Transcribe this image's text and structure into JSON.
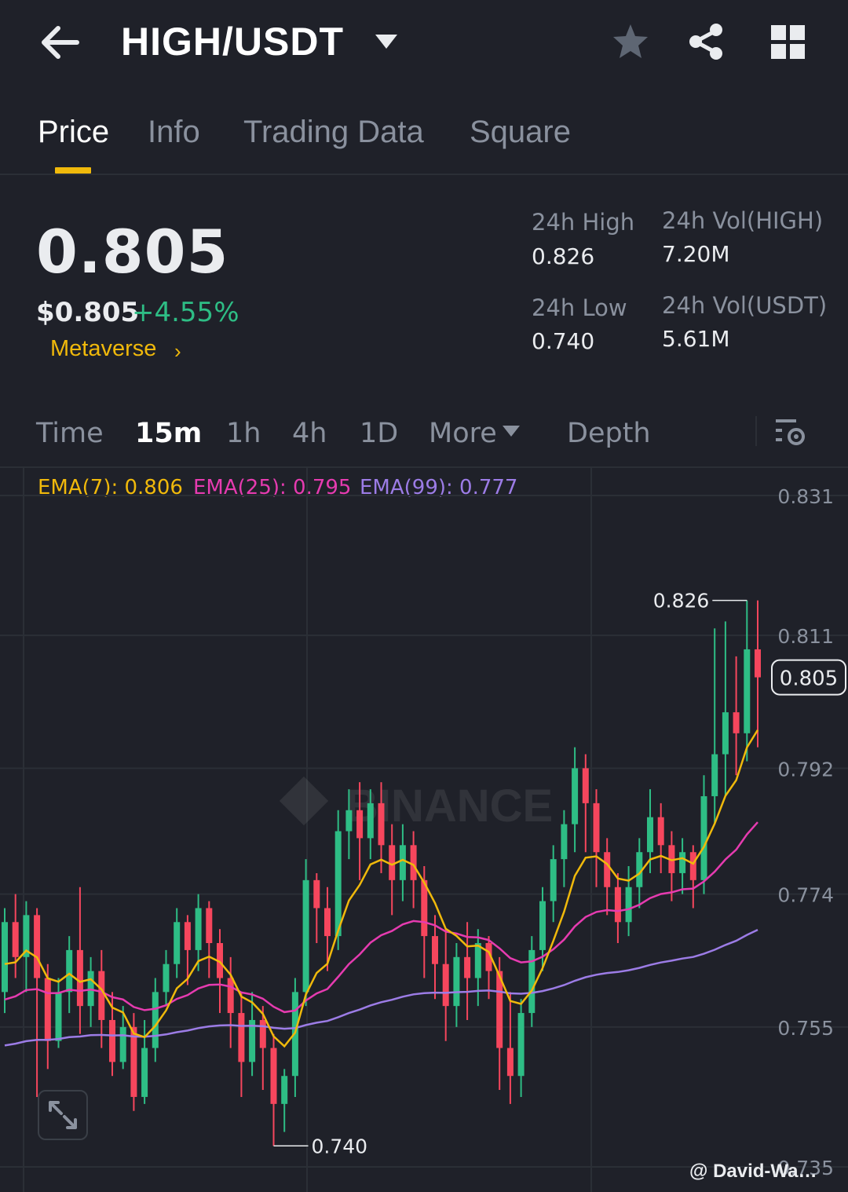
{
  "header": {
    "pair": "HIGH/USDT",
    "icons": [
      "back-arrow-icon",
      "caret-down-icon",
      "star-icon",
      "share-icon",
      "grid-icon"
    ]
  },
  "tabs": [
    {
      "label": "Price",
      "active": true
    },
    {
      "label": "Info",
      "active": false
    },
    {
      "label": "Trading Data",
      "active": false
    },
    {
      "label": "Square",
      "active": false
    }
  ],
  "ticker": {
    "last_price": "0.805",
    "usd_price": "$0.805",
    "change": "+4.55%",
    "tag": "Metaverse",
    "stats": {
      "high_label": "24h High",
      "high_value": "0.826",
      "low_label": "24h Low",
      "low_value": "0.740",
      "vol_base_label": "24h Vol(HIGH)",
      "vol_base_value": "7.20M",
      "vol_quote_label": "24h Vol(USDT)",
      "vol_quote_value": "5.61M"
    }
  },
  "intervals": [
    {
      "label": "Time",
      "active": false
    },
    {
      "label": "15m",
      "active": true
    },
    {
      "label": "1h",
      "active": false
    },
    {
      "label": "4h",
      "active": false
    },
    {
      "label": "1D",
      "active": false
    },
    {
      "label": "More",
      "active": false
    },
    {
      "label": "Depth",
      "active": false
    }
  ],
  "indicators": {
    "ema7": "EMA(7): 0.806",
    "ema25": "EMA(25): 0.795",
    "ema99": "EMA(99): 0.777"
  },
  "colors": {
    "up": "#2ebd85",
    "down": "#f6465d",
    "accent": "#f0b90b",
    "ema7": "#f0b90b",
    "ema25": "#e63bb0",
    "ema99": "#9c7ce6",
    "background": "#1f2129"
  },
  "watermark_logo": "BINANCE",
  "credit": "@ David-Wa…",
  "chart_data": {
    "type": "candlestick",
    "y_ticks": [
      "0.831",
      "0.811",
      "0.792",
      "0.774",
      "0.755",
      "0.735"
    ],
    "ylim": [
      0.735,
      0.831
    ],
    "current_price": "0.805",
    "max_marker": "0.826",
    "min_marker": "0.740",
    "candles": [
      [
        0.76,
        0.77,
        0.757,
        0.772
      ],
      [
        0.77,
        0.765,
        0.762,
        0.774
      ],
      [
        0.765,
        0.771,
        0.76,
        0.773
      ],
      [
        0.771,
        0.762,
        0.745,
        0.772
      ],
      [
        0.762,
        0.753,
        0.749,
        0.764
      ],
      [
        0.753,
        0.76,
        0.752,
        0.762
      ],
      [
        0.76,
        0.766,
        0.757,
        0.768
      ],
      [
        0.766,
        0.758,
        0.754,
        0.775
      ],
      [
        0.758,
        0.763,
        0.755,
        0.765
      ],
      [
        0.763,
        0.756,
        0.752,
        0.766
      ],
      [
        0.756,
        0.75,
        0.748,
        0.76
      ],
      [
        0.75,
        0.755,
        0.749,
        0.758
      ],
      [
        0.755,
        0.745,
        0.743,
        0.757
      ],
      [
        0.745,
        0.752,
        0.744,
        0.756
      ],
      [
        0.752,
        0.76,
        0.75,
        0.762
      ],
      [
        0.76,
        0.764,
        0.758,
        0.766
      ],
      [
        0.764,
        0.77,
        0.762,
        0.772
      ],
      [
        0.77,
        0.766,
        0.761,
        0.771
      ],
      [
        0.766,
        0.772,
        0.763,
        0.774
      ],
      [
        0.772,
        0.767,
        0.762,
        0.773
      ],
      [
        0.767,
        0.762,
        0.757,
        0.769
      ],
      [
        0.762,
        0.757,
        0.752,
        0.765
      ],
      [
        0.757,
        0.75,
        0.745,
        0.76
      ],
      [
        0.75,
        0.756,
        0.748,
        0.76
      ],
      [
        0.756,
        0.752,
        0.746,
        0.758
      ],
      [
        0.752,
        0.744,
        0.738,
        0.754
      ],
      [
        0.744,
        0.748,
        0.74,
        0.749
      ],
      [
        0.748,
        0.76,
        0.745,
        0.762
      ],
      [
        0.76,
        0.776,
        0.758,
        0.779
      ],
      [
        0.776,
        0.772,
        0.767,
        0.777
      ],
      [
        0.772,
        0.768,
        0.763,
        0.775
      ],
      [
        0.768,
        0.783,
        0.766,
        0.786
      ],
      [
        0.783,
        0.786,
        0.779,
        0.789
      ],
      [
        0.786,
        0.782,
        0.776,
        0.79
      ],
      [
        0.782,
        0.787,
        0.779,
        0.789
      ],
      [
        0.787,
        0.781,
        0.777,
        0.79
      ],
      [
        0.781,
        0.776,
        0.771,
        0.784
      ],
      [
        0.776,
        0.781,
        0.773,
        0.784
      ],
      [
        0.781,
        0.776,
        0.772,
        0.783
      ],
      [
        0.776,
        0.768,
        0.762,
        0.778
      ],
      [
        0.768,
        0.764,
        0.759,
        0.771
      ],
      [
        0.764,
        0.758,
        0.753,
        0.769
      ],
      [
        0.758,
        0.765,
        0.755,
        0.767
      ],
      [
        0.765,
        0.762,
        0.756,
        0.77
      ],
      [
        0.762,
        0.767,
        0.758,
        0.769
      ],
      [
        0.767,
        0.763,
        0.759,
        0.768
      ],
      [
        0.763,
        0.752,
        0.746,
        0.765
      ],
      [
        0.752,
        0.748,
        0.744,
        0.76
      ],
      [
        0.748,
        0.757,
        0.745,
        0.759
      ],
      [
        0.757,
        0.766,
        0.755,
        0.768
      ],
      [
        0.766,
        0.773,
        0.763,
        0.775
      ],
      [
        0.773,
        0.779,
        0.77,
        0.781
      ],
      [
        0.779,
        0.784,
        0.775,
        0.786
      ],
      [
        0.784,
        0.792,
        0.78,
        0.795
      ],
      [
        0.792,
        0.787,
        0.78,
        0.794
      ],
      [
        0.787,
        0.78,
        0.775,
        0.789
      ],
      [
        0.78,
        0.775,
        0.771,
        0.782
      ],
      [
        0.775,
        0.77,
        0.767,
        0.777
      ],
      [
        0.77,
        0.775,
        0.768,
        0.778
      ],
      [
        0.775,
        0.78,
        0.772,
        0.782
      ],
      [
        0.78,
        0.785,
        0.777,
        0.789
      ],
      [
        0.785,
        0.781,
        0.777,
        0.787
      ],
      [
        0.781,
        0.777,
        0.773,
        0.783
      ],
      [
        0.777,
        0.78,
        0.774,
        0.782
      ],
      [
        0.78,
        0.776,
        0.772,
        0.781
      ],
      [
        0.776,
        0.788,
        0.774,
        0.791
      ],
      [
        0.788,
        0.794,
        0.784,
        0.812
      ],
      [
        0.794,
        0.8,
        0.788,
        0.813
      ],
      [
        0.8,
        0.797,
        0.791,
        0.808
      ],
      [
        0.797,
        0.809,
        0.793,
        0.816
      ],
      [
        0.809,
        0.805,
        0.795,
        0.816
      ]
    ]
  }
}
